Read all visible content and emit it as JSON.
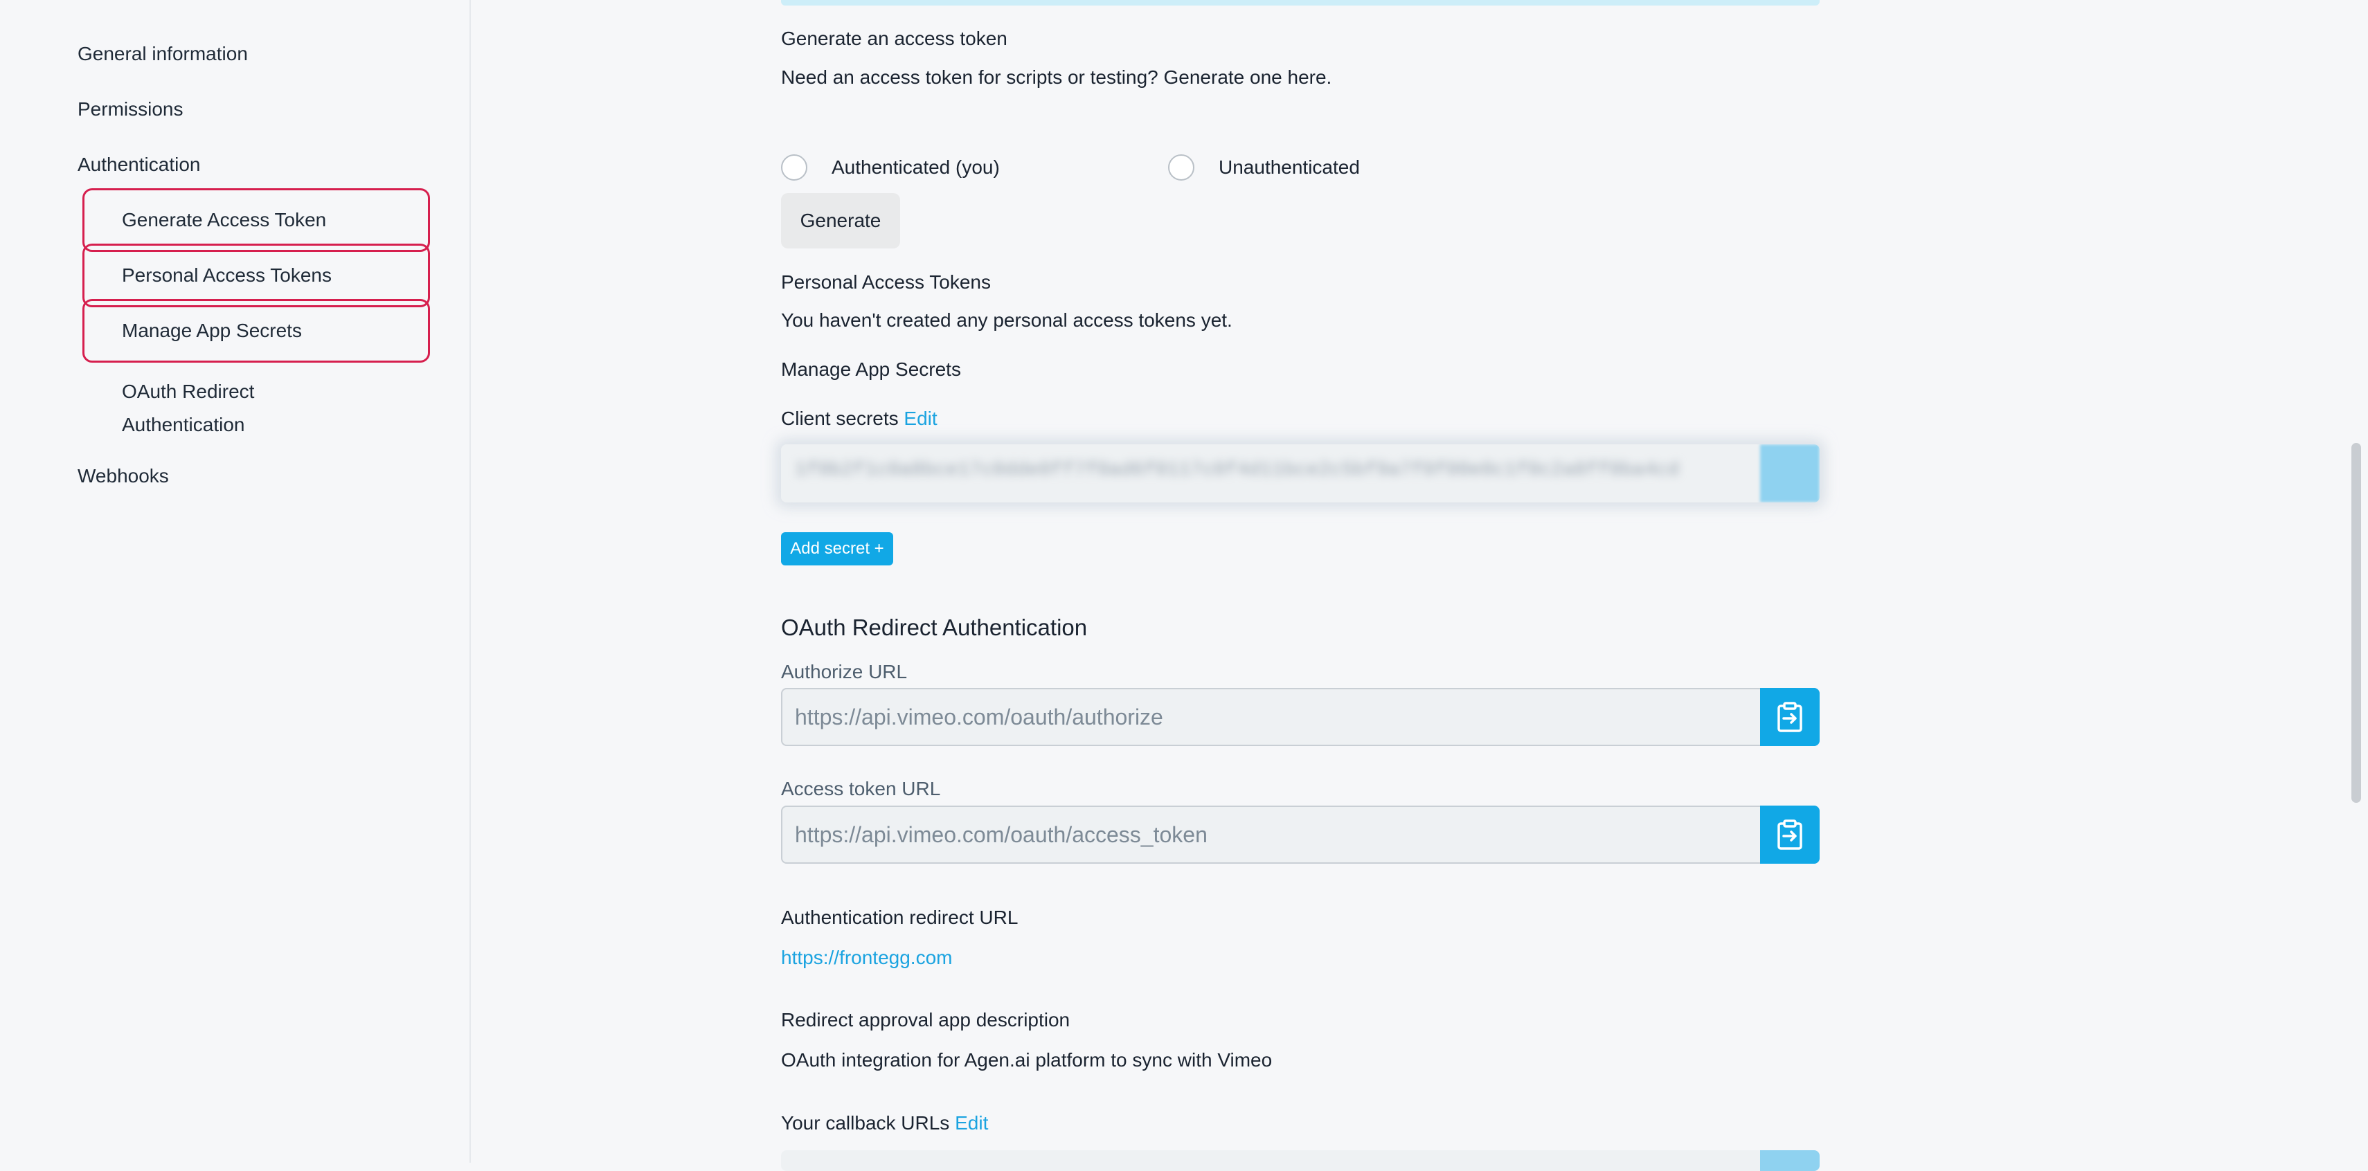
{
  "sidebar": {
    "items": [
      {
        "label": "General information"
      },
      {
        "label": "Permissions"
      },
      {
        "label": "Authentication"
      }
    ],
    "auth_subitems": [
      {
        "label": "Generate Access Token"
      },
      {
        "label": "Personal Access Tokens"
      },
      {
        "label": "Manage App Secrets"
      },
      {
        "label_line1": "OAuth Redirect",
        "label_line2": "Authentication"
      }
    ],
    "webhooks": "Webhooks"
  },
  "generate": {
    "heading": "Generate an access token",
    "description": "Need an access token for scripts or testing? Generate one here.",
    "radio_auth": "Authenticated (you)",
    "radio_unauth": "Unauthenticated",
    "button": "Generate"
  },
  "personal": {
    "heading": "Personal Access Tokens",
    "empty": "You haven't created any personal access tokens yet."
  },
  "secrets": {
    "heading": "Manage App Secrets",
    "client_label": "Client secrets",
    "edit": "Edit",
    "masked_value": "1f0b2f1c0a8bce17c0dde0ff7f0ad6f0117c0f4d11bce2c5bf9a7f0f00e0c1f0c2a8ff0ba4cd",
    "add_button": "Add secret +"
  },
  "oauth": {
    "heading": "OAuth Redirect Authentication",
    "authorize_label": "Authorize URL",
    "authorize_value": "https://api.vimeo.com/oauth/authorize",
    "token_label": "Access token URL",
    "token_value": "https://api.vimeo.com/oauth/access_token",
    "redirect_label": "Authentication redirect URL",
    "redirect_value": "https://frontegg.com",
    "approval_label": "Redirect approval app description",
    "approval_value": "OAuth integration for Agen.ai platform to sync with Vimeo",
    "callback_label": "Your callback URLs",
    "callback_edit": "Edit"
  },
  "colors": {
    "accent": "#11a8e6",
    "highlight": "#d61f4e"
  }
}
